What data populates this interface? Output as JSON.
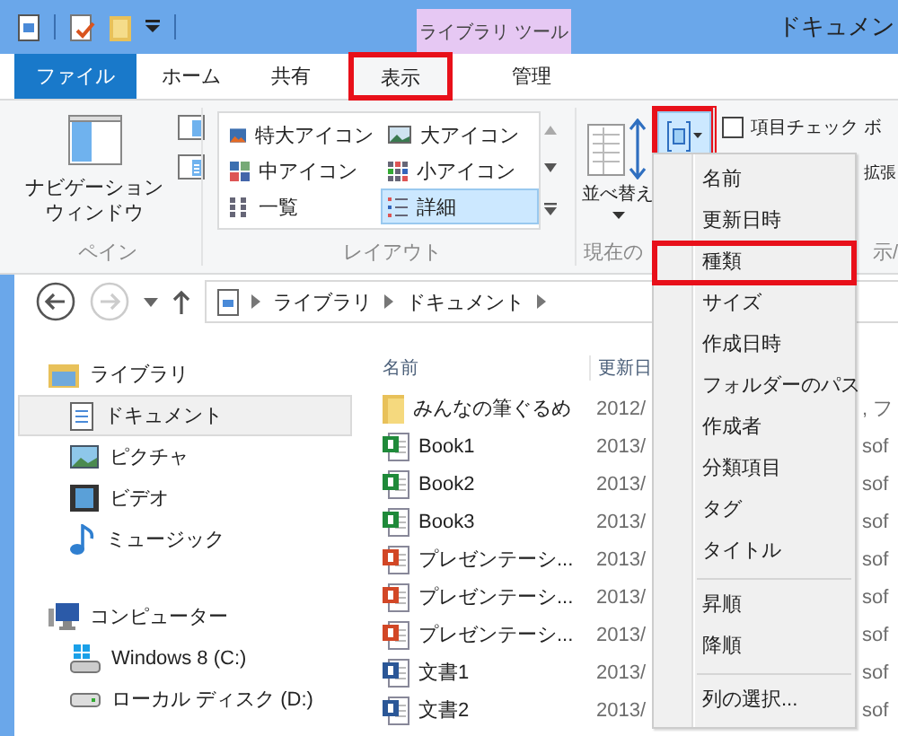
{
  "title_bar": {
    "context_group": "ライブラリ ツール",
    "title": "ドキュメン"
  },
  "tabs": [
    {
      "label": "ファイル",
      "kind": "file",
      "selected": false,
      "highlighted": false
    },
    {
      "label": "ホーム",
      "kind": "tab",
      "selected": false,
      "highlighted": false
    },
    {
      "label": "共有",
      "kind": "tab",
      "selected": false,
      "highlighted": false
    },
    {
      "label": "表示",
      "kind": "tab",
      "selected": true,
      "highlighted": true
    },
    {
      "label": "管理",
      "kind": "context",
      "selected": false,
      "highlighted": false
    }
  ],
  "ribbon": {
    "pane_group": {
      "button_lines": [
        "ナビゲーション",
        "ウィンドウ"
      ],
      "label": "ペイン"
    },
    "layout_group": {
      "label": "レイアウト",
      "options": [
        {
          "label": "特大アイコン",
          "kind": "xl",
          "selected": false
        },
        {
          "label": "大アイコン",
          "kind": "large",
          "selected": false
        },
        {
          "label": "中アイコン",
          "kind": "medium",
          "selected": false
        },
        {
          "label": "小アイコン",
          "kind": "small",
          "selected": false
        },
        {
          "label": "一覧",
          "kind": "list",
          "selected": false
        },
        {
          "label": "詳細",
          "kind": "details",
          "selected": true
        }
      ]
    },
    "current_view_group": {
      "sort_button": "並べ替え",
      "label": "現在の",
      "group_button_highlighted": true
    },
    "show_group": {
      "checkbox": {
        "label": "項目チェック ボ",
        "checked": false
      },
      "option": "拡張",
      "label": "示/"
    }
  },
  "address": {
    "forward_disabled": true,
    "crumbs": [
      "ライブラリ",
      "ドキュメント"
    ]
  },
  "nav_tree": [
    {
      "label": "ライブラリ",
      "kind": "library",
      "selected": false,
      "children": [
        {
          "label": "ドキュメント",
          "kind": "documents",
          "selected": true
        },
        {
          "label": "ピクチャ",
          "kind": "pictures",
          "selected": false
        },
        {
          "label": "ビデオ",
          "kind": "videos",
          "selected": false
        },
        {
          "label": "ミュージック",
          "kind": "music",
          "selected": false
        }
      ]
    },
    {
      "label": "コンピューター",
      "kind": "computer",
      "selected": false,
      "children": [
        {
          "label": "Windows 8 (C:)",
          "kind": "system_drive",
          "selected": false
        },
        {
          "label": "ローカル ディスク (D:)",
          "kind": "drive",
          "selected": false
        }
      ]
    }
  ],
  "file_list": {
    "columns": [
      "名前",
      "更新日"
    ],
    "rows": [
      {
        "name": "みんなの筆ぐるめ",
        "kind": "folder",
        "date": "2012/",
        "column_3": ", フ"
      },
      {
        "name": "Book1",
        "kind": "excel",
        "date": "2013/",
        "column_3": "sof"
      },
      {
        "name": "Book2",
        "kind": "excel",
        "date": "2013/",
        "column_3": "sof"
      },
      {
        "name": "Book3",
        "kind": "excel",
        "date": "2013/",
        "column_3": "sof"
      },
      {
        "name": "プレゼンテーシ...",
        "kind": "powerpoint",
        "date": "2013/",
        "column_3": "sof"
      },
      {
        "name": "プレゼンテーシ...",
        "kind": "powerpoint",
        "date": "2013/",
        "column_3": "sof"
      },
      {
        "name": "プレゼンテーシ...",
        "kind": "powerpoint",
        "date": "2013/",
        "column_3": "sof"
      },
      {
        "name": "文書1",
        "kind": "word",
        "date": "2013/",
        "column_3": "sof"
      },
      {
        "name": "文書2",
        "kind": "word",
        "date": "2013/",
        "column_3": "sof"
      }
    ]
  },
  "group_by_menu": {
    "sections": [
      [
        {
          "label": "名前",
          "highlighted": false
        },
        {
          "label": "更新日時",
          "highlighted": false
        },
        {
          "label": "種類",
          "highlighted": true
        },
        {
          "label": "サイズ",
          "highlighted": false
        },
        {
          "label": "作成日時",
          "highlighted": false
        },
        {
          "label": "フォルダーのパス",
          "highlighted": false
        },
        {
          "label": "作成者",
          "highlighted": false
        },
        {
          "label": "分類項目",
          "highlighted": false
        },
        {
          "label": "タグ",
          "highlighted": false
        },
        {
          "label": "タイトル",
          "highlighted": false
        }
      ],
      [
        {
          "label": "昇順",
          "highlighted": false
        },
        {
          "label": "降順",
          "highlighted": false
        }
      ],
      [
        {
          "label": "列の選択...",
          "highlighted": false
        }
      ]
    ]
  }
}
